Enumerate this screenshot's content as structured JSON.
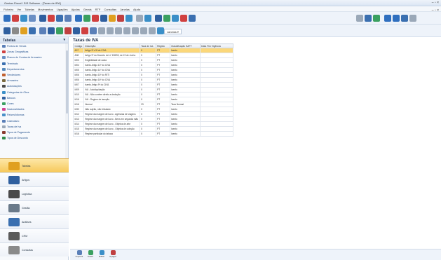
{
  "window": {
    "title": "Gestao Fiscal / SIS Software - [Taxas de IRA]",
    "controls": "– ▫ ×"
  },
  "menu": {
    "items": [
      "Ficheiro",
      "Ver",
      "Tabelas",
      "Movimentos",
      "Ligações",
      "Ajudas",
      "Gerais",
      "RTF",
      "Consultas",
      "Janelas",
      "Ajuda"
    ],
    "mdi_controls": "– ▫ ×"
  },
  "toolbar2": {
    "dropdown_label": "Janelas ▾"
  },
  "sidebar": {
    "header": "Tabelas",
    "pin": "▾",
    "items": [
      {
        "label": "Pontos de Venda",
        "icon": "pos-icon",
        "color": "#5a7fb8"
      },
      {
        "label": "Zonas Geográficas",
        "icon": "zone-icon",
        "color": "#d04040"
      },
      {
        "label": "Planos de Contas de Armazém",
        "icon": "plan-icon",
        "color": "#6a8fc4"
      },
      {
        "label": "Terminais",
        "icon": "terminal-icon",
        "color": "#3a6fb0"
      },
      {
        "label": "Departamentos",
        "icon": "department-icon",
        "color": "#5588bb"
      },
      {
        "label": "Vendedores",
        "icon": "sellers-icon",
        "color": "#c06030"
      },
      {
        "label": "Armazéns",
        "icon": "warehouse-icon",
        "color": "#7a6a40"
      },
      {
        "label": "Autorizações",
        "icon": "authorization-icon",
        "color": "#4a4a4a"
      },
      {
        "label": "Categorias de Obra",
        "icon": "category-icon",
        "color": "#3a8fc8"
      },
      {
        "label": "Bancos",
        "icon": "bank-icon",
        "color": "#2f5f9f"
      },
      {
        "label": "Cores",
        "icon": "colors-icon",
        "color": "#3aa060"
      },
      {
        "label": "Nacionalidades",
        "icon": "nationality-icon",
        "color": "#d04090"
      },
      {
        "label": "Países/Idiomas",
        "icon": "country-icon",
        "color": "#4a90c8"
      },
      {
        "label": "Calendário",
        "icon": "calendar-icon",
        "color": "#5a7fb8"
      },
      {
        "label": "Taxas de Iva",
        "icon": "tax-icon",
        "color": "#9aa8b8"
      },
      {
        "label": "Tipos de Pagamento",
        "icon": "payment-icon",
        "color": "#8a3a30"
      },
      {
        "label": "Tipos de Desconto",
        "icon": "discount-icon",
        "color": "#2f8a4a"
      }
    ]
  },
  "nav": {
    "items": [
      {
        "label": "Tabelas",
        "icon": "tables-icon",
        "color": "#e0a020",
        "active": true
      },
      {
        "label": "Artigos",
        "icon": "articles-icon",
        "color": "#2f5f9f",
        "active": false
      },
      {
        "label": "Logística",
        "icon": "logistics-icon",
        "color": "#4a4a4a",
        "active": false
      },
      {
        "label": "Gestão",
        "icon": "management-icon",
        "color": "#6a7a8a",
        "active": false
      },
      {
        "label": "Análises",
        "icon": "analysis-icon",
        "color": "#3a6fb0",
        "active": false
      },
      {
        "label": "CRM",
        "icon": "crm-icon",
        "color": "#5a5a5a",
        "active": false
      },
      {
        "label": "Consultas",
        "icon": "queries-icon",
        "color": "#8a8a8a",
        "active": false
      }
    ]
  },
  "main": {
    "title": "Taxas de IVA",
    "columns": [
      "Código",
      "Descrição",
      "Taxa de Iva",
      "Região",
      "Classificação SAFT",
      "Data Fim Vigência"
    ],
    "rows": [
      [
        "A07",
        "Artigo 9º nº8 do CIVA",
        "0",
        "PT",
        "Isento",
        ""
      ],
      [
        "A08",
        "Artigo 9º do Decreto Lei nº 198/90, de 19 de Junho",
        "0",
        "PT",
        "Isento",
        ""
      ],
      [
        "M03",
        "Exigibilidade de caixa",
        "0",
        "PT",
        "Isento",
        ""
      ],
      [
        "M04",
        "Isento Artigo 13º do CIVA",
        "0",
        "PT",
        "Isento",
        ""
      ],
      [
        "M05",
        "Isento Artigo 14º do CIVA",
        "0",
        "PT",
        "Isento",
        ""
      ],
      [
        "M06",
        "Isento Artigo 15º do RITI",
        "0",
        "PT",
        "Isento",
        ""
      ],
      [
        "M06",
        "Isento Artigo 16º do CIVA",
        "0",
        "PT",
        "Isento",
        ""
      ],
      [
        "M07",
        "Isento Artigo 9º do CIVA",
        "0",
        "PT",
        "Isento",
        ""
      ],
      [
        "M09",
        "IVA - Autoliquidação",
        "0",
        "PT",
        "Isento",
        ""
      ],
      [
        "M10",
        "IVA - Não confere direito a dedução",
        "0",
        "PT",
        "Isento",
        ""
      ],
      [
        "M16",
        "IVA - Regime de isenção",
        "0",
        "PT",
        "Isento",
        ""
      ],
      [
        "M16",
        "Normal",
        "23",
        "PT",
        "Taxa Normal",
        ""
      ],
      [
        "M30",
        "Não sujeito, não tributado",
        "0",
        "PT",
        "Isento",
        ""
      ],
      [
        "M12",
        "Regime da margem de lucro - Agências de viagens",
        "0",
        "PT",
        "Isento",
        ""
      ],
      [
        "M13",
        "Regime da margem de lucro - Bens em segunda mão",
        "0",
        "PT",
        "Isento",
        ""
      ],
      [
        "M14",
        "Regime da margem de lucro - Objetos de arte",
        "0",
        "PT",
        "Isento",
        ""
      ],
      [
        "M15",
        "Regime da margem de lucro - Objetos de coleção",
        "0",
        "PT",
        "Isento",
        ""
      ],
      [
        "M16",
        "Regime particular do tabaco",
        "0",
        "PT",
        "Isento",
        ""
      ]
    ],
    "selected_row": 0
  },
  "bottombar": {
    "buttons": [
      {
        "label": "Imprimir",
        "icon": "print-icon",
        "color": "#5a7fb8"
      },
      {
        "label": "Inserir",
        "icon": "insert-icon",
        "color": "#3aa060"
      },
      {
        "label": "Editar",
        "icon": "edit-icon",
        "color": "#3a8fc8"
      },
      {
        "label": "Apagar",
        "icon": "delete-icon",
        "color": "#c04040"
      }
    ]
  }
}
